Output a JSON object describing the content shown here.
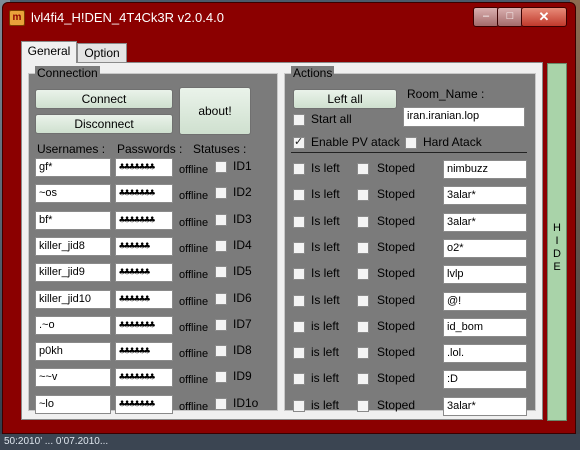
{
  "window": {
    "title": "lvl4fi4_H!DEN_4T4Ck3R v2.0.4.0",
    "icon_text": "m"
  },
  "taskbar_text": "50:2010’ ... 0’07.2010...",
  "tabs": [
    "General",
    "Option"
  ],
  "connection": {
    "legend": "Connection",
    "connect_label": "Connect",
    "disconnect_label": "Disconnect",
    "about_label": "about!",
    "col_usernames": "Usernames :",
    "col_passwords": "Passwords :",
    "col_statuses": "Statuses :",
    "rows": [
      {
        "user": "gf*",
        "pass": "♣♣♣♣♣♣♣",
        "status": "offline",
        "id": "ID1"
      },
      {
        "user": "~os",
        "pass": "♣♣♣♣♣♣♣",
        "status": "offline",
        "id": "ID2"
      },
      {
        "user": "bf*",
        "pass": "♣♣♣♣♣♣♣",
        "status": "offline",
        "id": "ID3"
      },
      {
        "user": "killer_jid8",
        "pass": "♣♣♣♣♣♣",
        "status": "offline",
        "id": "ID4"
      },
      {
        "user": "killer_jid9",
        "pass": "♣♣♣♣♣♣",
        "status": "offline",
        "id": "ID5"
      },
      {
        "user": "killer_jid10",
        "pass": "♣♣♣♣♣♣",
        "status": "offline",
        "id": "ID6"
      },
      {
        "user": ".~o",
        "pass": "♣♣♣♣♣♣♣",
        "status": "offline",
        "id": "ID7"
      },
      {
        "user": "p0kh",
        "pass": "♣♣♣♣♣♣",
        "status": "offline",
        "id": "ID8"
      },
      {
        "user": "~~v",
        "pass": "♣♣♣♣♣♣♣",
        "status": "offline",
        "id": "ID9"
      },
      {
        "user": "~lo",
        "pass": "♣♣♣♣♣♣♣",
        "status": "offline",
        "id": "ID1o"
      }
    ]
  },
  "actions": {
    "legend": "Actions",
    "left_all_label": "Left all",
    "room_name_label": "Room_Name :",
    "room_name_value": "iran.iranian.lop",
    "start_all_label": "Start all",
    "enable_pv_label": "Enable PV atack",
    "enable_pv_checked": true,
    "hard_atack_label": "Hard Atack",
    "is_left_label": "Is left",
    "stoped_label": "Stoped",
    "rows": [
      {
        "left_label": "Is left",
        "msg": "nimbuzz"
      },
      {
        "left_label": "Is left",
        "msg": "3alar*"
      },
      {
        "left_label": "Is left",
        "msg": "3alar*"
      },
      {
        "left_label": "Is left",
        "msg": "o2*"
      },
      {
        "left_label": "Is left",
        "msg": "lvlp"
      },
      {
        "left_label": "Is left",
        "msg": "@!"
      },
      {
        "left_label": "is left",
        "msg": "id_bom"
      },
      {
        "left_label": "is left",
        "msg": ".lol."
      },
      {
        "left_label": "is left",
        "msg": ":D"
      },
      {
        "left_label": "is left",
        "msg": "3alar*"
      }
    ]
  },
  "hide_label": "H I D E",
  "colors": {
    "window_frame": "#8b0000",
    "group_bg": "#7b7b7b",
    "button_bg": "#d8e8d8",
    "hide_bar": "#a9d3a9"
  }
}
